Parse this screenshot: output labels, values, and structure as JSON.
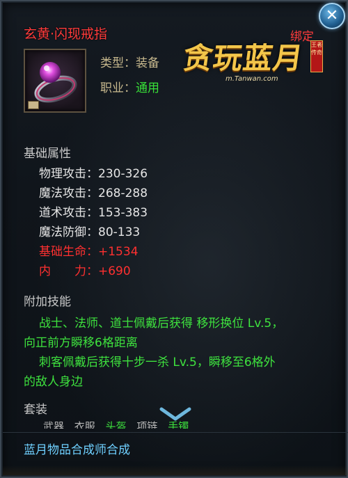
{
  "item": {
    "name": "玄黄·闪现戒指",
    "bind": "绑定",
    "icon": "ring-icon",
    "type_label": "类型：",
    "type_value": "装备",
    "job_label": "职业：",
    "job_value": "通用"
  },
  "logo": {
    "title": "贪玩蓝月",
    "seal": "王者传奇",
    "url": "m.Tanwan.com"
  },
  "base_attrs": {
    "title": "基础属性",
    "rows": [
      {
        "label": "物理攻击：",
        "value": "230-326"
      },
      {
        "label": "魔法攻击：",
        "value": "268-288"
      },
      {
        "label": "道术攻击：",
        "value": "153-383"
      },
      {
        "label": "魔法防御：",
        "value": "80-133"
      },
      {
        "label": "基础生命：",
        "value": "+1534"
      },
      {
        "label": "内　　力：",
        "value": "+690"
      }
    ]
  },
  "skills": {
    "title": "附加技能",
    "lines": [
      "战士、法师、道士佩戴后获得 移形换位 Lv.5，",
      "向正前方瞬移6格距离",
      "刺客佩戴后获得十步一杀 Lv.5，瞬移至6格外",
      "的敌人身边"
    ]
  },
  "suit": {
    "title": "套装",
    "pieces": [
      "武器",
      "衣服",
      "头盔",
      "项链",
      "手镯"
    ]
  },
  "footer": {
    "crafter": "蓝月物品合成师合成"
  },
  "colors": {
    "name_red": "#ff3b3b",
    "green": "#3ee23e",
    "blue_text": "#6fd0ff",
    "label_gold": "#c8b98e"
  }
}
